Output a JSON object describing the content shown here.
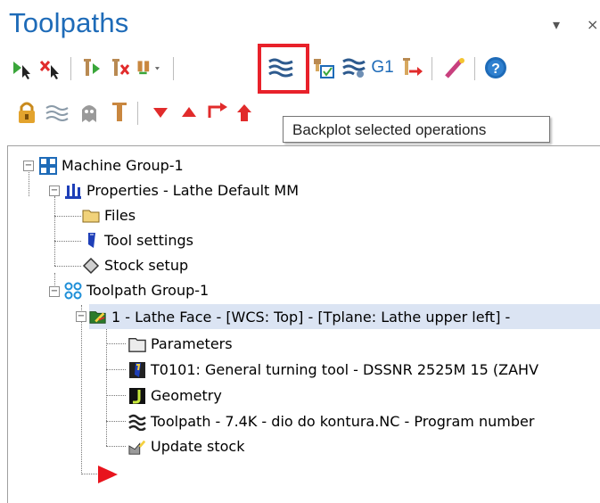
{
  "panel": {
    "title": "Toolpaths",
    "dropdown_glyph": "▾",
    "close_glyph": "×"
  },
  "toolbar1": {
    "items": [
      {
        "name": "select-all-operations-icon"
      },
      {
        "name": "deselect-all-operations-icon"
      },
      {
        "name": "regenerate-selected-icon"
      },
      {
        "name": "regenerate-dirty-icon"
      },
      {
        "name": "toggle-operations-icon"
      },
      {
        "name": "backplot-selected-operations-icon"
      },
      {
        "name": "verify-selected-operations-icon"
      },
      {
        "name": "simulate-icon"
      },
      {
        "name": "g1-post-icon",
        "label": "G1"
      },
      {
        "name": "post-selected-operations-icon"
      },
      {
        "name": "highfeed-icon"
      },
      {
        "name": "help-icon",
        "label": "?"
      }
    ]
  },
  "tooltip": {
    "text": "Backplot selected operations"
  },
  "tree": {
    "machine_group": "Machine Group-1",
    "properties": "Properties - Lathe Default MM",
    "files": "Files",
    "tool_settings": "Tool settings",
    "stock_setup": "Stock setup",
    "toolpath_group": "Toolpath Group-1",
    "operation": "1 - Lathe Face - [WCS: Top] - [Tplane: Lathe upper left] -",
    "parameters": "Parameters",
    "tool": "T0101: General turning tool - DSSNR 2525M 15 (ZAHV",
    "geometry": "Geometry",
    "toolpath": "Toolpath - 7.4K - dio do kontura.NC - Program number",
    "update_stock": "Update stock"
  },
  "colors": {
    "title_blue": "#1e6bb8",
    "highlight_red": "#e8212a",
    "selection_bg": "#dbe4f3",
    "insert_arrow_red": "#e8141d"
  }
}
